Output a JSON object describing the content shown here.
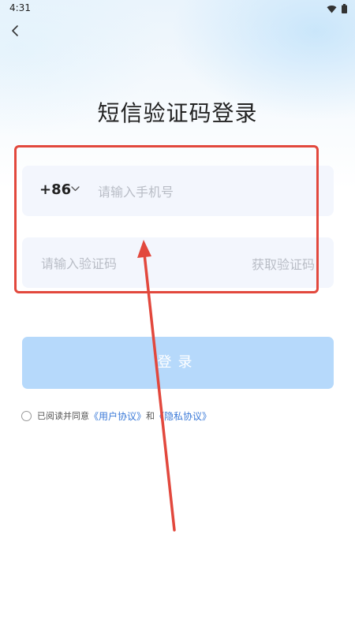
{
  "status_bar": {
    "time": "4:31"
  },
  "page": {
    "title": "短信验证码登录"
  },
  "phone": {
    "country_code": "+86",
    "placeholder": "请输入手机号",
    "value": ""
  },
  "code": {
    "placeholder": "请输入验证码",
    "value": "",
    "get_code_label": "获取验证码"
  },
  "login": {
    "label": "登录"
  },
  "agreement": {
    "prefix": "已阅读并同意",
    "user_agreement": "《用户协议》",
    "conjunction": "和",
    "privacy_policy": "《隐私协议》"
  },
  "colors": {
    "accent_link": "#3b7ad8",
    "login_button_disabled": "#b6d9fb",
    "annotation_red": "#e2483d",
    "input_background": "#f3f6fd"
  },
  "icons": {
    "back": "chevron-left-icon",
    "country_dropdown": "chevron-down-icon",
    "wifi": "wifi-icon",
    "battery": "battery-icon"
  }
}
